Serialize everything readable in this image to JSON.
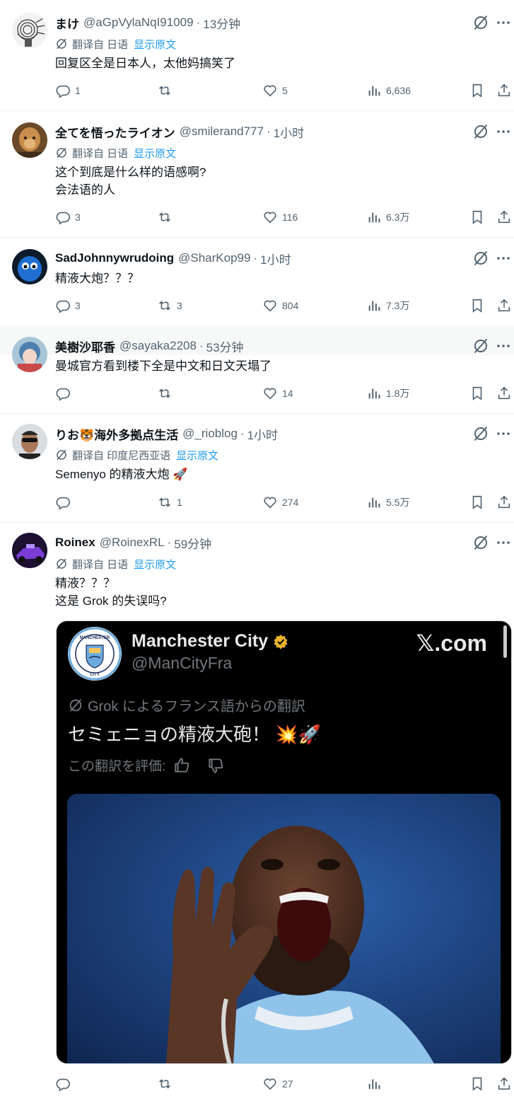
{
  "tweets": [
    {
      "name": "まけ",
      "handle": "@aGpVylaNqI91009",
      "time": "13分钟",
      "translate_label": "翻译自 日语",
      "show_original": "显示原文",
      "lines": [
        "回复区全是日本人，太他妈搞笑了"
      ],
      "replies": "1",
      "retweets": "",
      "likes": "5",
      "views": "6,636"
    },
    {
      "name": "全てを悟ったライオン",
      "handle": "@smilerand777",
      "time": "1小时",
      "translate_label": "翻译自 日语",
      "show_original": "显示原文",
      "lines": [
        "这个到底是什么样的语感啊?",
        "会法语的人"
      ],
      "replies": "3",
      "retweets": "",
      "likes": "116",
      "views": "6.3万"
    },
    {
      "name": "SadJohnnywrudoing",
      "handle": "@SharKop99",
      "time": "1小时",
      "lines": [
        "精液大炮？？？"
      ],
      "replies": "3",
      "retweets": "3",
      "likes": "804",
      "views": "7.3万"
    },
    {
      "name": "美樹沙耶香",
      "handle": "@sayaka2208",
      "time": "53分钟",
      "lines": [
        "曼城官方看到楼下全是中文和日文天塌了"
      ],
      "replies": "",
      "retweets": "",
      "likes": "14",
      "views": "1.8万"
    },
    {
      "name": "りお🐯海外多拠点生活",
      "handle": "@_rioblog",
      "time": "1小时",
      "translate_label": "翻译自 印度尼西亚语",
      "show_original": "显示原文",
      "lines": [
        "Semenyo 的精液大炮 🚀"
      ],
      "replies": "",
      "retweets": "1",
      "likes": "274",
      "views": "5.5万"
    },
    {
      "name": "Roinex",
      "handle": "@RoinexRL",
      "time": "59分钟",
      "translate_label": "翻译自 日语",
      "show_original": "显示原文",
      "lines": [
        "精液？？？",
        "这是 Grok 的失误吗?"
      ],
      "replies": "",
      "retweets": "",
      "likes": "27",
      "views": ""
    }
  ],
  "embedded": {
    "name": "Manchester City",
    "handle": "@ManCityFra",
    "site": "𝕏.com",
    "grok_label": "Grok によるフランス語からの翻訳",
    "text": "セミェニョの精液大砲！ 💥🚀",
    "rate_label": "この翻訳を評価:",
    "logo_text": "MANCHESTER",
    "logo_text2": "CITY"
  },
  "colors": {
    "accent": "#1d9bf0",
    "muted": "#536471",
    "text": "#0f1419",
    "divider": "#eff3f4"
  },
  "icons": [
    "reply-icon",
    "retweet-icon",
    "like-icon",
    "views-icon",
    "bookmark-icon",
    "share-icon",
    "grok-icon",
    "more-icon",
    "verified-icon",
    "thumbs-up-icon",
    "thumbs-down-icon"
  ]
}
